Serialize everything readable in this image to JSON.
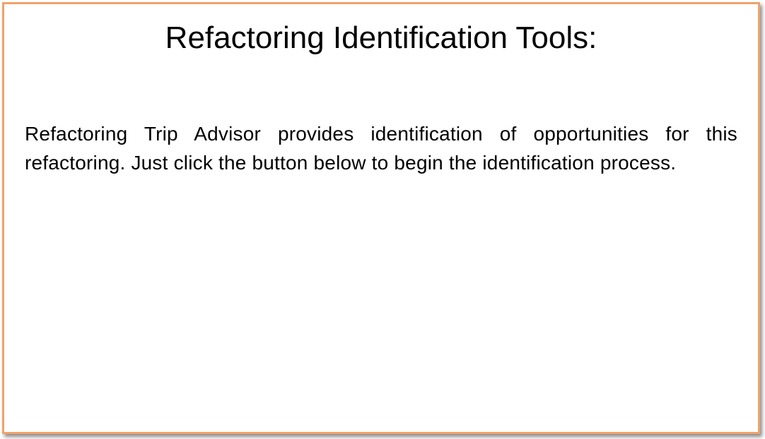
{
  "slide": {
    "title": "Refactoring Identification Tools:",
    "description": "Refactoring Trip Advisor provides identification of opportunities for this refactoring. Just click the button below to begin the identification process."
  },
  "colors": {
    "border": "#f0a36a",
    "background": "#ffffff",
    "text": "#000000"
  }
}
